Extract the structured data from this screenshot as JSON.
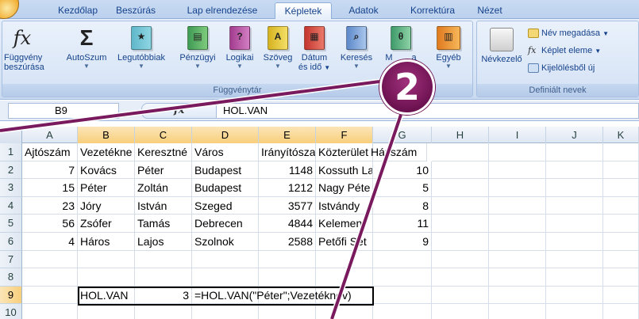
{
  "tabs": [
    {
      "label": "Kezdőlap"
    },
    {
      "label": "Beszúrás"
    },
    {
      "label": "Lap elrendezése"
    },
    {
      "label": "Képletek",
      "active": true
    },
    {
      "label": "Adatok"
    },
    {
      "label": "Korrektúra"
    },
    {
      "label": "Nézet"
    }
  ],
  "ribbon": {
    "function_library": {
      "group_label": "Függvénytár",
      "buttons": {
        "insert_function": {
          "line1": "Függvény",
          "line2": "beszúrása",
          "icon": "fx-icon"
        },
        "autosum": {
          "label": "AutoSzum",
          "icon": "sigma-icon"
        },
        "recent": {
          "label": "Legutóbbiak",
          "icon": "book-star-icon"
        },
        "financial": {
          "label": "Pénzügyi",
          "icon": "book-money-icon"
        },
        "logical": {
          "label": "Logikai",
          "icon": "book-question-icon"
        },
        "text": {
          "label": "Szöveg",
          "icon": "book-a-icon"
        },
        "datetime": {
          "line1": "Dátum",
          "line2": "és idő",
          "icon": "book-calendar-icon"
        },
        "lookup": {
          "label": "Keresés",
          "icon": "book-magnifier-icon"
        },
        "math": {
          "label": "M",
          "icon": "book-theta-icon"
        },
        "trig_suffix": "a",
        "more": {
          "label": "Egyéb",
          "icon": "books-icon"
        }
      }
    },
    "defined_names": {
      "group_label": "Definiált nevek",
      "name_manager": {
        "label": "Névkezelő",
        "icon": "name-manager-icon"
      },
      "define_name": "Név megadása",
      "use_in_formula": "Képlet eleme",
      "create_from_selection": "Kijelölésből új"
    }
  },
  "formula_bar": {
    "name_box": "B9",
    "fx": "fx",
    "formula": "HOL.VAN"
  },
  "columns": [
    "A",
    "B",
    "C",
    "D",
    "E",
    "F",
    "G",
    "H",
    "I",
    "J",
    "K"
  ],
  "rows": [
    {
      "n": "1",
      "A": "Ajtószám",
      "B": "Vezetékne",
      "C": "Keresztné",
      "D": "Város",
      "E": "Irányítósza",
      "F": "Közterület",
      "G": "Házszám"
    },
    {
      "n": "2",
      "A": "7",
      "B": "Kovács",
      "C": "Péter",
      "D": "Budapest",
      "E": "1148",
      "F": "Kossuth La",
      "G": "10"
    },
    {
      "n": "3",
      "A": "15",
      "B": "Péter",
      "C": "Zoltán",
      "D": "Budapest",
      "E": "1212",
      "F": "Nagy Péte",
      "G": "5"
    },
    {
      "n": "4",
      "A": "23",
      "B": "Jóry",
      "C": "István",
      "D": "Szeged",
      "E": "3577",
      "F": "Istvándy",
      "G": "8"
    },
    {
      "n": "5",
      "A": "56",
      "B": "Zsófer",
      "C": "Tamás",
      "D": "Debrecen",
      "E": "4844",
      "F": "Kelemen",
      "G": "11"
    },
    {
      "n": "6",
      "A": "4",
      "B": "Háros",
      "C": "Lajos",
      "D": "Szolnok",
      "E": "2588",
      "F": "Petőfi Sét",
      "G": "9"
    },
    {
      "n": "7"
    },
    {
      "n": "8"
    },
    {
      "n": "9",
      "B": "HOL.VAN",
      "C": "3",
      "D": "=HOL.VAN(\"Péter\";Vezetéknév)"
    },
    {
      "n": "10"
    }
  ],
  "callout": {
    "number": "2"
  },
  "colors": {
    "accent": "#6d1251",
    "selected_header": "#f8cf7c"
  }
}
